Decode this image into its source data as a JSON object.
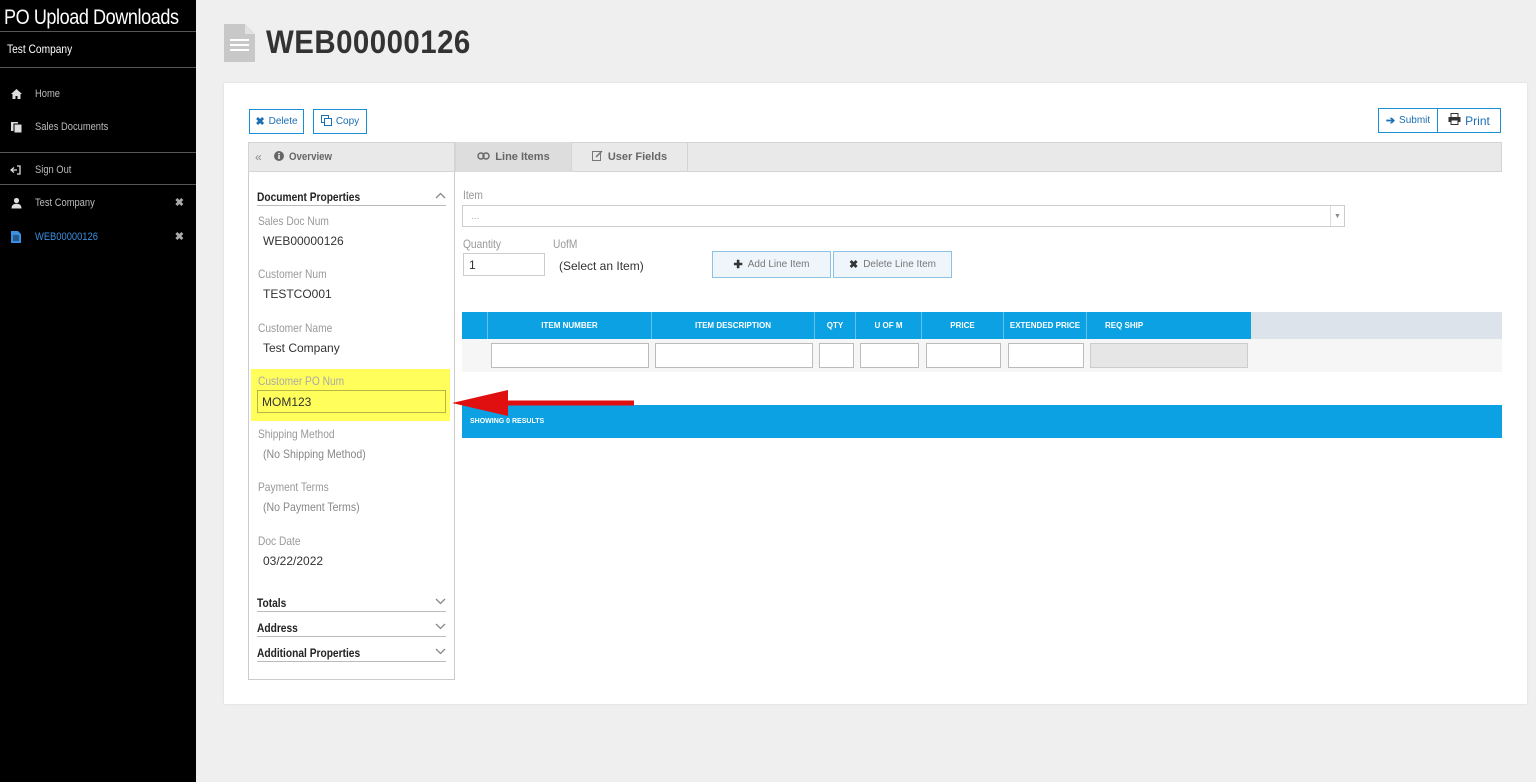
{
  "sidebar": {
    "app_title": "PO Upload  Downloads",
    "company": "Test Company",
    "nav": [
      {
        "label": "Home",
        "icon": "home-icon"
      },
      {
        "label": "Sales Documents",
        "icon": "documents-icon"
      }
    ],
    "sign_out": "Sign Out",
    "open_items": [
      {
        "label": "Test Company",
        "icon": "user-icon",
        "active": false
      },
      {
        "label": "WEB00000126",
        "icon": "file-icon",
        "active": true
      }
    ]
  },
  "header": {
    "title": "WEB00000126"
  },
  "toolbar": {
    "delete_label": "Delete",
    "copy_label": "Copy",
    "submit_label": "Submit",
    "print_label": "Print"
  },
  "tabs": {
    "overview": "Overview",
    "line_items": "Line Items",
    "user_fields": "User Fields"
  },
  "document_properties": {
    "heading": "Document Properties",
    "fields": {
      "sales_doc_num": {
        "label": "Sales Doc Num",
        "value": "WEB00000126"
      },
      "customer_num": {
        "label": "Customer Num",
        "value": "TESTCO001"
      },
      "customer_name": {
        "label": "Customer Name",
        "value": "Test Company"
      },
      "customer_po_num": {
        "label": "Customer PO Num",
        "value": "MOM123"
      },
      "shipping_method": {
        "label": "Shipping Method",
        "value": "(No Shipping Method)"
      },
      "payment_terms": {
        "label": "Payment Terms",
        "value": "(No Payment Terms)"
      },
      "doc_date": {
        "label": "Doc Date",
        "value": "03/22/2022"
      }
    }
  },
  "collapsed_sections": {
    "totals": "Totals",
    "address": "Address",
    "additional": "Additional Properties"
  },
  "line_item_form": {
    "item_label": "Item",
    "item_value": "...",
    "quantity_label": "Quantity",
    "quantity_value": "1",
    "uofm_label": "UofM",
    "uofm_value": "(Select an Item)",
    "add_button": "Add Line Item",
    "delete_button": "Delete Line Item"
  },
  "grid": {
    "columns": [
      "ITEM NUMBER",
      "ITEM DESCRIPTION",
      "QTY",
      "U OF M",
      "PRICE",
      "EXTENDED PRICE",
      "REQ SHIP"
    ],
    "footer": "SHOWING 0 RESULTS"
  },
  "colors": {
    "accent": "#0ba1e2",
    "highlight": "#fffe5a",
    "annotation_arrow": "#e01010"
  }
}
